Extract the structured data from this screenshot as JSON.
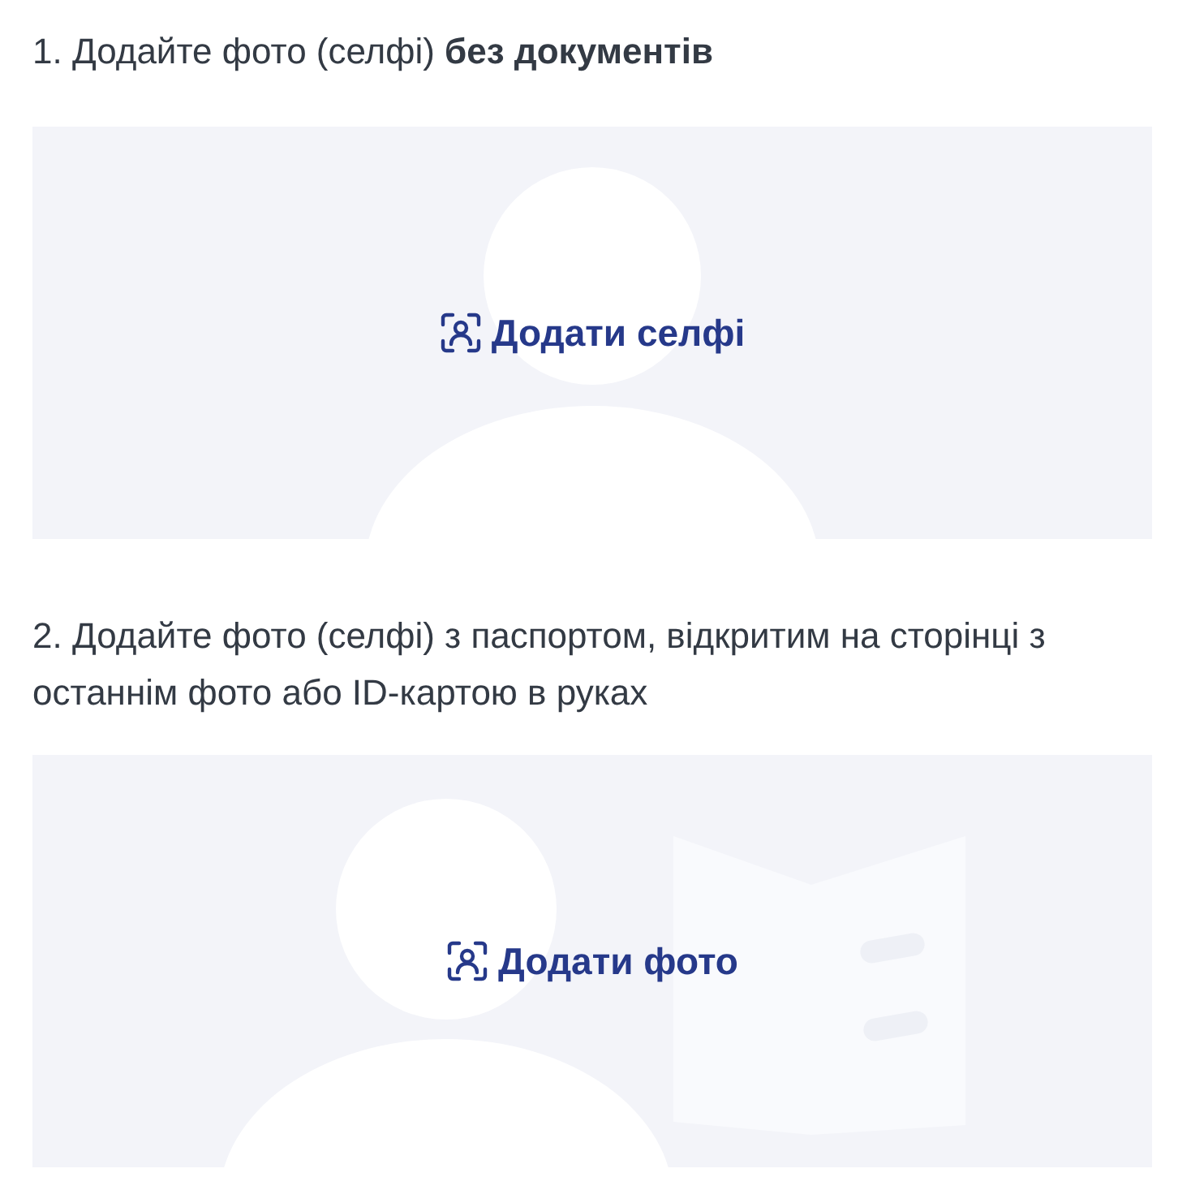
{
  "steps": [
    {
      "instruction": "1. Додайте фото (селфі) **без документів**",
      "kind": "selfie",
      "button": "Додати селфі"
    },
    {
      "instruction": "2. Додайте фото (селфі) з паспортом, відкритим на сторінці з останнім фото або ID-картою в руках",
      "kind": "passport",
      "button": "Додати фото"
    }
  ]
}
